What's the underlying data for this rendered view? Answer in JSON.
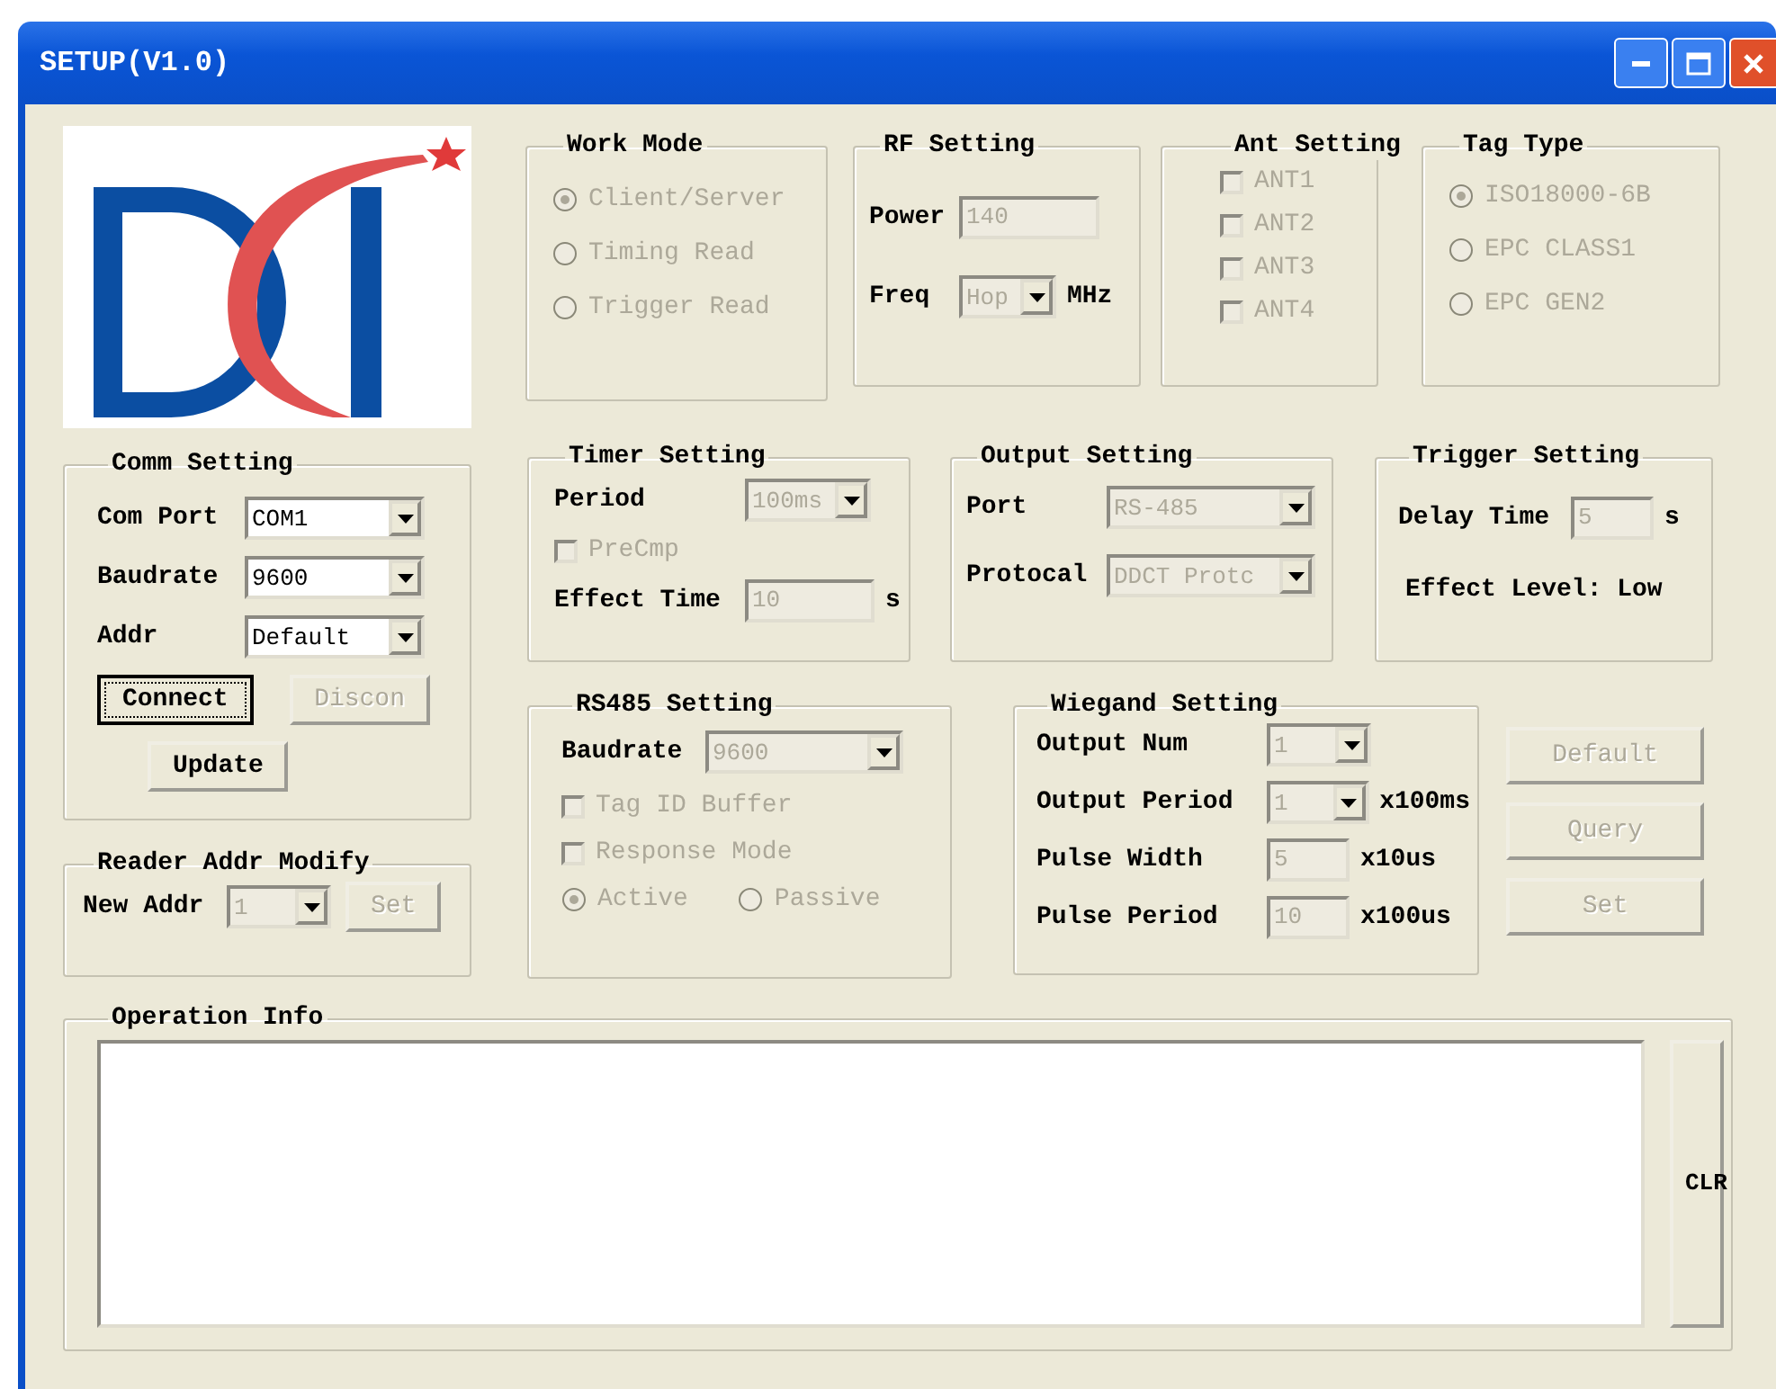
{
  "window": {
    "title": "SETUP(V1.0)"
  },
  "top_groups": [
    {
      "title": "Work Mode",
      "rows": [
        {
          "items": [
            {
              "kind": "radio",
              "label": "Client/Server",
              "selected": true,
              "disabled": true
            }
          ]
        },
        {
          "items": [
            {
              "kind": "radio",
              "label": "Timing Read",
              "selected": false,
              "disabled": true
            }
          ]
        },
        {
          "items": [
            {
              "kind": "radio",
              "label": "Trigger Read",
              "selected": false,
              "disabled": true
            }
          ]
        }
      ]
    },
    {
      "title": "RF Setting",
      "rows": [
        {
          "items": [
            {
              "kind": "label",
              "text": "Power"
            },
            {
              "kind": "edit",
              "value": "140",
              "disabled": true
            }
          ]
        },
        {
          "items": [
            {
              "kind": "label",
              "text": "Freq"
            },
            {
              "kind": "combo",
              "value": "Hop",
              "disabled": true
            },
            {
              "kind": "unit",
              "text": "MHz"
            }
          ]
        }
      ]
    },
    {
      "title": "Ant Setting",
      "rows": [
        {
          "items": [
            {
              "kind": "check",
              "label": "ANT1",
              "checked": false,
              "disabled": true
            }
          ]
        },
        {
          "items": [
            {
              "kind": "check",
              "label": "ANT2",
              "checked": false,
              "disabled": true
            }
          ]
        },
        {
          "items": [
            {
              "kind": "check",
              "label": "ANT3",
              "checked": false,
              "disabled": true
            }
          ]
        },
        {
          "items": [
            {
              "kind": "check",
              "label": "ANT4",
              "checked": false,
              "disabled": true
            }
          ]
        }
      ]
    },
    {
      "title": "Tag Type",
      "rows": [
        {
          "items": [
            {
              "kind": "radio",
              "label": "ISO18000-6B",
              "selected": true,
              "disabled": true
            }
          ]
        },
        {
          "items": [
            {
              "kind": "radio",
              "label": "EPC CLASS1",
              "selected": false,
              "disabled": true
            }
          ]
        },
        {
          "items": [
            {
              "kind": "radio",
              "label": "EPC GEN2",
              "selected": false,
              "disabled": true
            }
          ]
        }
      ]
    }
  ],
  "left_groups": [
    {
      "title": "Comm Setting",
      "rows": [
        {
          "items": [
            {
              "kind": "label",
              "text": "Com Port"
            },
            {
              "kind": "combo",
              "value": "COM1",
              "disabled": false
            }
          ]
        },
        {
          "items": [
            {
              "kind": "label",
              "text": "Baudrate"
            },
            {
              "kind": "combo",
              "value": "9600",
              "disabled": false
            }
          ]
        },
        {
          "items": [
            {
              "kind": "label",
              "text": "Addr"
            },
            {
              "kind": "combo",
              "value": "Default",
              "disabled": false
            }
          ]
        },
        {
          "items": [
            {
              "kind": "button",
              "label": "Connect",
              "disabled": false,
              "focused": true
            },
            {
              "kind": "button",
              "label": "Discon",
              "disabled": true,
              "focused": false
            }
          ]
        },
        {
          "items": [
            {
              "kind": "button",
              "label": "Update",
              "disabled": false,
              "focused": false
            }
          ]
        }
      ]
    },
    {
      "title": "Reader Addr Modify",
      "rows": [
        {
          "items": [
            {
              "kind": "label",
              "text": "New Addr"
            },
            {
              "kind": "combo",
              "value": "1",
              "disabled": true
            },
            {
              "kind": "button",
              "label": "Set",
              "disabled": true,
              "focused": false
            }
          ]
        }
      ]
    }
  ],
  "right_groups": [
    {
      "title": "Timer Setting",
      "rows": [
        {
          "items": [
            {
              "kind": "label",
              "text": "Period"
            },
            {
              "kind": "combo",
              "value": "100ms",
              "disabled": true
            }
          ]
        },
        {
          "items": [
            {
              "kind": "check",
              "label": "PreCmp",
              "checked": false,
              "disabled": true
            }
          ]
        },
        {
          "items": [
            {
              "kind": "label",
              "text": "Effect Time"
            },
            {
              "kind": "edit",
              "value": "10",
              "disabled": true
            },
            {
              "kind": "unit",
              "text": "s"
            }
          ]
        }
      ]
    },
    {
      "title": "Output Setting",
      "rows": [
        {
          "items": [
            {
              "kind": "label",
              "text": "Port"
            },
            {
              "kind": "combo",
              "value": "RS-485",
              "disabled": true
            }
          ]
        },
        {
          "items": [
            {
              "kind": "label",
              "text": "Protocal"
            },
            {
              "kind": "combo",
              "value": "DDCT Protc",
              "disabled": true
            }
          ]
        }
      ]
    },
    {
      "title": "Trigger Setting",
      "rows": [
        {
          "items": [
            {
              "kind": "label",
              "text": "Delay Time"
            },
            {
              "kind": "edit",
              "value": "5",
              "disabled": true
            },
            {
              "kind": "unit",
              "text": "s"
            }
          ]
        },
        {
          "items": [
            {
              "kind": "text",
              "text": "Effect Level: Low"
            }
          ]
        }
      ]
    },
    {
      "title": "RS485 Setting",
      "rows": [
        {
          "items": [
            {
              "kind": "label",
              "text": "Baudrate"
            },
            {
              "kind": "combo",
              "value": "9600",
              "disabled": true
            }
          ]
        },
        {
          "items": [
            {
              "kind": "check",
              "label": "Tag ID Buffer",
              "checked": false,
              "disabled": true
            }
          ]
        },
        {
          "items": [
            {
              "kind": "check",
              "label": "Response Mode",
              "checked": false,
              "disabled": true
            }
          ]
        },
        {
          "items": [
            {
              "kind": "radio",
              "label": "Active",
              "selected": true,
              "disabled": true
            },
            {
              "kind": "radio",
              "label": "Passive",
              "selected": false,
              "disabled": true
            }
          ]
        }
      ]
    },
    {
      "title": "Wiegand Setting",
      "rows": [
        {
          "items": [
            {
              "kind": "label",
              "text": "Output Num"
            },
            {
              "kind": "combo",
              "value": "1",
              "disabled": true
            }
          ]
        },
        {
          "items": [
            {
              "kind": "label",
              "text": "Output Period"
            },
            {
              "kind": "combo",
              "value": "1",
              "disabled": true
            },
            {
              "kind": "unit",
              "text": "x100ms"
            }
          ]
        },
        {
          "items": [
            {
              "kind": "label",
              "text": "Pulse Width"
            },
            {
              "kind": "edit",
              "value": "5",
              "disabled": true
            },
            {
              "kind": "unit",
              "text": "x10us"
            }
          ]
        },
        {
          "items": [
            {
              "kind": "label",
              "text": "Pulse Period"
            },
            {
              "kind": "edit",
              "value": "10",
              "disabled": true
            },
            {
              "kind": "unit",
              "text": "x100us"
            }
          ]
        }
      ]
    }
  ],
  "side_buttons": [
    {
      "label": "Default",
      "disabled": true
    },
    {
      "label": "Query",
      "disabled": true
    },
    {
      "label": "Set",
      "disabled": true
    }
  ],
  "operation_info": {
    "title": "Operation Info",
    "clear_button": "CLR"
  }
}
